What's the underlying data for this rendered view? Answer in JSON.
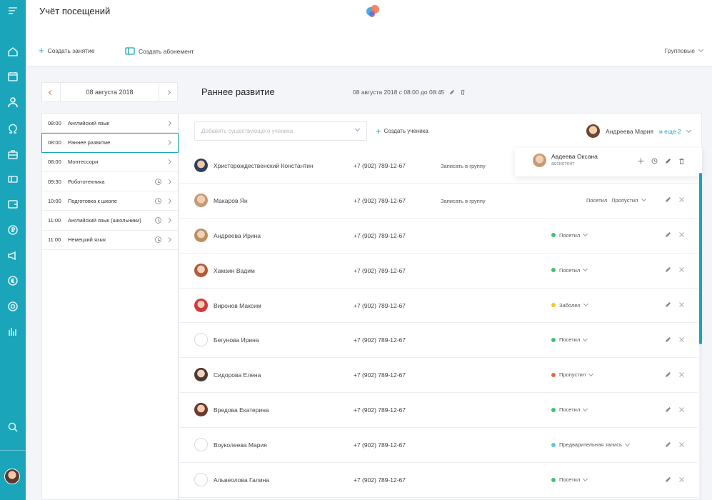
{
  "app": {
    "title": "Учёт посещений",
    "accent": "#1aa5ba"
  },
  "sidebar": {
    "items": [
      {
        "icon": "menu-icon"
      },
      {
        "icon": "home-icon"
      },
      {
        "icon": "calendar-icon"
      },
      {
        "icon": "user-icon"
      },
      {
        "icon": "omega-icon"
      },
      {
        "icon": "briefcase-icon"
      },
      {
        "icon": "ticket-icon"
      },
      {
        "icon": "wallet-icon"
      },
      {
        "icon": "ruble-icon"
      },
      {
        "icon": "megaphone-icon"
      },
      {
        "icon": "euro-icon"
      },
      {
        "icon": "support-icon"
      },
      {
        "icon": "bar-chart-icon"
      },
      {
        "icon": "search-icon"
      }
    ]
  },
  "toolbar": {
    "create_lesson": "Создать занятие",
    "create_subscription": "Создать абонемент",
    "type_select": "Групповые"
  },
  "date_nav": {
    "date": "08 августа 2018"
  },
  "lessons": [
    {
      "time": "08:00",
      "name": "Английский язык",
      "has_clock": false,
      "active": false
    },
    {
      "time": "08:00",
      "name": "Раннее развитие",
      "has_clock": false,
      "active": true
    },
    {
      "time": "08:00",
      "name": "Монтессори",
      "has_clock": false,
      "active": false
    },
    {
      "time": "09:30",
      "name": "Робототехника",
      "has_clock": true,
      "active": false
    },
    {
      "time": "10:00",
      "name": "Подготовка к школе",
      "has_clock": true,
      "active": false
    },
    {
      "time": "11:00",
      "name": "Английский язык (школьники)",
      "has_clock": true,
      "active": false
    },
    {
      "time": "11:00",
      "name": "Немецкий язык",
      "has_clock": true,
      "active": false
    }
  ],
  "group": {
    "title": "Раннее развитие",
    "datetime": "08 августа 2018 с 08:00 до 08:45"
  },
  "panel": {
    "search_placeholder": "Добавить существующего ученика",
    "create_student": "Создать ученика",
    "teacher_name": "Андреева Мария",
    "teacher_more": "и еще 2"
  },
  "assistant": {
    "name": "Авдеева Оксана",
    "role": "ассистент"
  },
  "students": [
    {
      "name": "Христорождественский Константин",
      "phone": "+7 (902) 789-12-67",
      "enroll": "Записать в группу",
      "status": "",
      "status_color": "",
      "avatar": "f2"
    },
    {
      "name": "Макаров Ян",
      "phone": "+7 (902) 789-12-67",
      "enroll": "Записать в группу",
      "status": "",
      "status_color": "",
      "avatar": "f3",
      "choices": [
        "Посетил",
        "Пропустил"
      ]
    },
    {
      "name": "Андреева Ирина",
      "phone": "+7 (902) 789-12-67",
      "enroll": "",
      "status": "Посетил",
      "status_color": "#3cc46a",
      "avatar": "f4"
    },
    {
      "name": "Хамзин Вадим",
      "phone": "+7 (902) 789-12-67",
      "enroll": "",
      "status": "Посетил",
      "status_color": "#3cc46a",
      "avatar": "f5"
    },
    {
      "name": "Виронов Максим",
      "phone": "+7 (902) 789-12-67",
      "enroll": "",
      "status": "Заболел",
      "status_color": "#f2cc1c",
      "avatar": "f6"
    },
    {
      "name": "Бегунова Ирина",
      "phone": "+7 (902) 789-12-67",
      "enroll": "",
      "status": "Посетил",
      "status_color": "#3cc46a",
      "avatar": "empty"
    },
    {
      "name": "Сидорова Елена",
      "phone": "+7 (902) 789-12-67",
      "enroll": "",
      "status": "Пропустил",
      "status_color": "#e8634f",
      "avatar": "f7"
    },
    {
      "name": "Вредова Екатерина",
      "phone": "+7 (902) 789-12-67",
      "enroll": "",
      "status": "Посетил",
      "status_color": "#3cc46a",
      "avatar": "f8"
    },
    {
      "name": "Воуколеева Мария",
      "phone": "+7 (902) 789-12-67",
      "enroll": "",
      "status": "Предварительная запись",
      "status_color": "#5bc8d6",
      "avatar": "empty"
    },
    {
      "name": "Альвеолова Галина",
      "phone": "+7 (902) 789-12-67",
      "enroll": "",
      "status": "Посетил",
      "status_color": "#3cc46a",
      "avatar": "empty"
    }
  ]
}
